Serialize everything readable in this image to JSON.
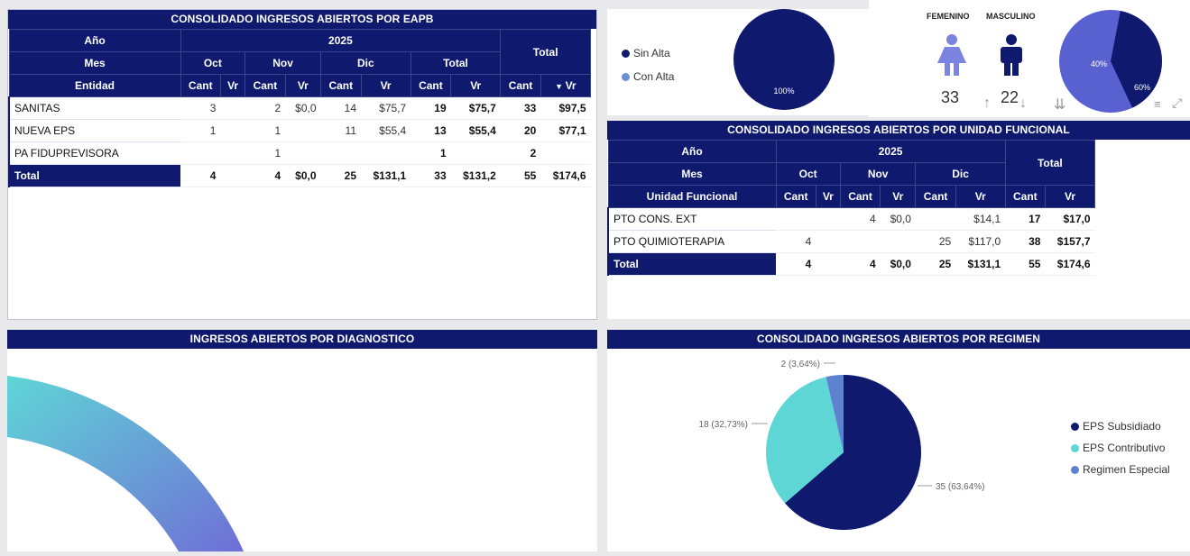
{
  "eapb": {
    "title": "CONSOLIDADO INGRESOS ABIERTOS POR EAPB",
    "hdr_anio": "Año",
    "hdr_year": "2025",
    "hdr_total": "Total",
    "hdr_mes": "Mes",
    "m_oct": "Oct",
    "m_nov": "Nov",
    "m_dic": "Dic",
    "m_total": "Total",
    "hdr_ent": "Entidad",
    "cant": "Cant",
    "vr": "Vr",
    "rows": [
      {
        "name": "SANITAS",
        "c": [
          "3",
          "",
          "2",
          "$0,0",
          "14",
          "$75,7",
          "19",
          "$75,7",
          "33",
          "$97,5"
        ]
      },
      {
        "name": "NUEVA EPS",
        "c": [
          "1",
          "",
          "1",
          "",
          "11",
          "$55,4",
          "13",
          "$55,4",
          "20",
          "$77,1"
        ]
      },
      {
        "name": "PA FIDUPREVISORA",
        "c": [
          "",
          "",
          "1",
          "",
          "",
          "",
          "1",
          "",
          "2",
          ""
        ]
      },
      {
        "name": "Total",
        "c": [
          "4",
          "",
          "4",
          "$0,0",
          "25",
          "$131,1",
          "33",
          "$131,2",
          "55",
          "$174,6"
        ]
      }
    ]
  },
  "alta": {
    "legend": [
      "Sin Alta",
      "Con Alta"
    ],
    "pie_label": "100%",
    "colors": {
      "sin": "#0f1a6e",
      "con": "#6b8fd6"
    }
  },
  "gender": {
    "fem_label": "FEMENINO",
    "masc_label": "MASCULINO",
    "fem_count": "33",
    "masc_count": "22",
    "pie_fem": "40%",
    "pie_masc": "60%",
    "colors": {
      "fem": "#7b84e0",
      "masc": "#0f1a6e",
      "pie_fem": "#0f1a6e",
      "pie_masc": "#5961d1"
    }
  },
  "unidad": {
    "title": "CONSOLIDADO INGRESOS ABIERTOS POR UNIDAD FUNCIONAL",
    "hdr_anio": "Año",
    "hdr_year": "2025",
    "hdr_total": "Total",
    "hdr_mes": "Mes",
    "m_oct": "Oct",
    "m_nov": "Nov",
    "m_dic": "Dic",
    "hdr_uf": "Unidad Funcional",
    "cant": "Cant",
    "vr": "Vr",
    "rows": [
      {
        "name": "PTO CONS. EXT",
        "c": [
          "",
          "",
          "4",
          "$0,0",
          "",
          "$14,1",
          "17",
          "$17,0"
        ]
      },
      {
        "name": "PTO QUIMIOTERAPIA",
        "c": [
          "4",
          "",
          "",
          "",
          "25",
          "$117,0",
          "38",
          "$157,7"
        ]
      },
      {
        "name": "Total",
        "c": [
          "4",
          "",
          "4",
          "$0,0",
          "25",
          "$131,1",
          "55",
          "$174,6"
        ]
      }
    ]
  },
  "diag": {
    "title": "INGRESOS ABIERTOS POR DIAGNOSTICO"
  },
  "regimen": {
    "title": "CONSOLIDADO INGRESOS ABIERTOS POR REGIMEN",
    "labels": {
      "esp": "2 (3,64%)",
      "cont": "18 (32,73%)",
      "sub": "35 (63,64%)"
    },
    "legend": [
      "EPS Subsidiado",
      "EPS Contributivo",
      "Regimen Especial"
    ],
    "colors": {
      "sub": "#0f1a6e",
      "cont": "#5fd6d6",
      "esp": "#5e82cf"
    }
  },
  "chart_data": [
    {
      "type": "pie",
      "categories": [
        "Sin Alta",
        "Con Alta"
      ],
      "values": [
        100,
        0
      ],
      "data_labels": [
        "100%"
      ]
    },
    {
      "type": "pie",
      "categories": [
        "FEMENINO",
        "MASCULINO"
      ],
      "values": [
        40,
        60
      ],
      "data_labels": [
        "40%",
        "60%"
      ]
    },
    {
      "type": "pie",
      "title": "CONSOLIDADO INGRESOS ABIERTOS POR REGIMEN",
      "categories": [
        "EPS Subsidiado",
        "EPS Contributivo",
        "Regimen Especial"
      ],
      "values": [
        35,
        18,
        2
      ],
      "legend": "right"
    }
  ]
}
